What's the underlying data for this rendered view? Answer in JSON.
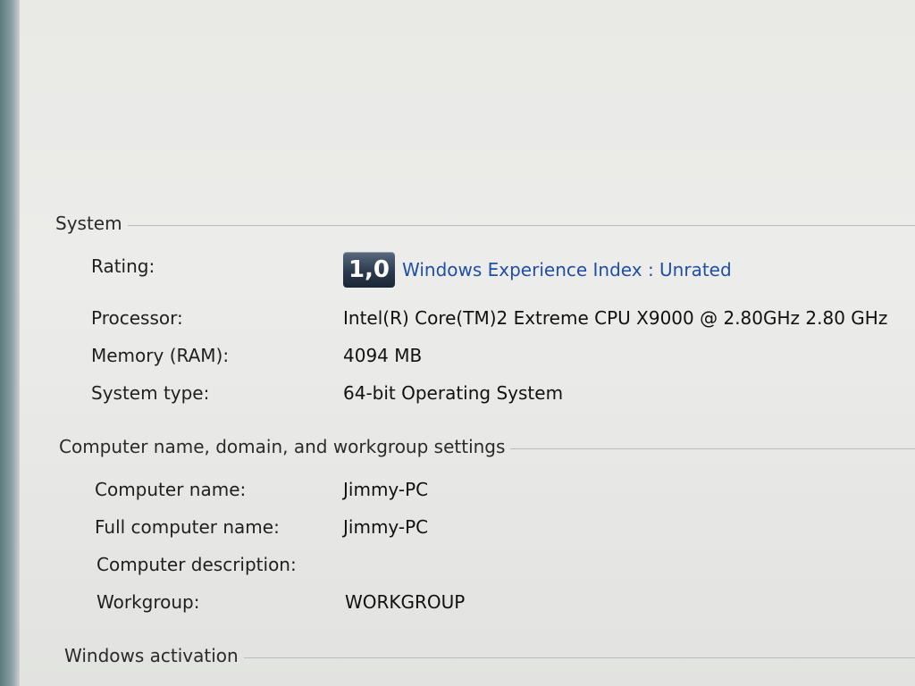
{
  "system": {
    "header": "System",
    "rating_label": "Rating:",
    "rating_value": "1,0",
    "rating_link": "Windows Experience Index : Unrated",
    "processor_label": "Processor:",
    "processor_value": "Intel(R) Core(TM)2 Extreme CPU X9000  @ 2.80GHz   2.80 GHz",
    "memory_label": "Memory (RAM):",
    "memory_value": "4094 MB",
    "system_type_label": "System type:",
    "system_type_value": "64-bit Operating System"
  },
  "computer": {
    "header": "Computer name, domain, and workgroup settings",
    "name_label": "Computer name:",
    "name_value": "Jimmy-PC",
    "full_name_label": "Full computer name:",
    "full_name_value": "Jimmy-PC",
    "description_label": "Computer description:",
    "description_value": "",
    "workgroup_label": "Workgroup:",
    "workgroup_value": "WORKGROUP"
  },
  "activation": {
    "header": "Windows activation"
  },
  "colors": {
    "link": "#1f4fa8",
    "badge_dark": "#2c3a4d"
  },
  "icons": {
    "rating_badge": "windows-experience-index-badge-icon"
  }
}
